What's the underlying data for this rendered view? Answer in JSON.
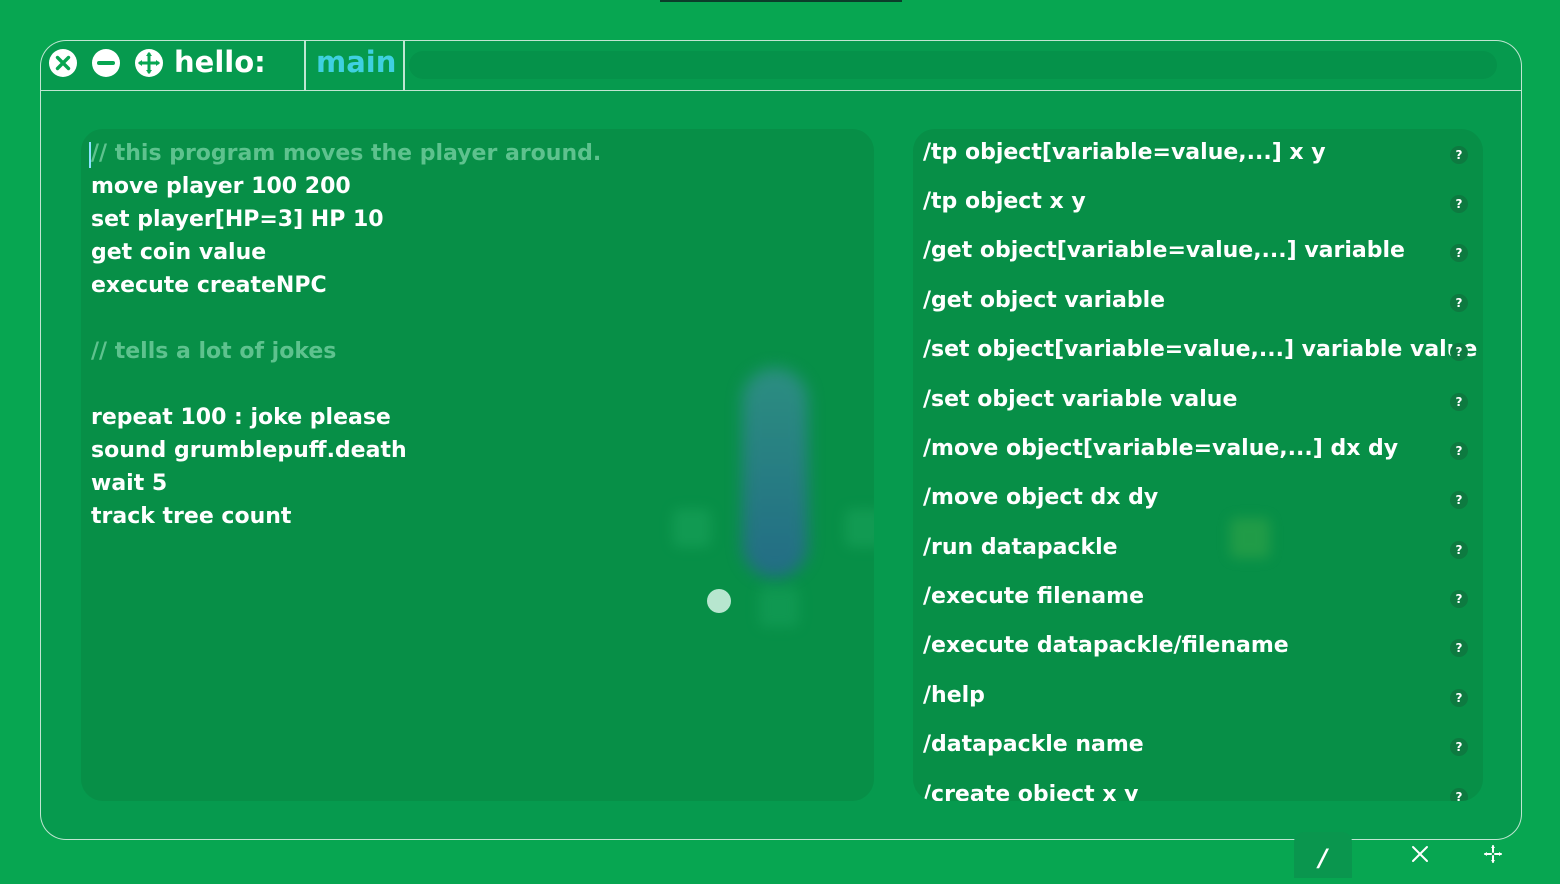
{
  "window": {
    "title": "hello:",
    "active_tab": "main"
  },
  "editor": {
    "lines": [
      {
        "text": "// this program moves the player around.",
        "comment": true
      },
      {
        "text": "move player 100 200",
        "comment": false
      },
      {
        "text": "set player[HP=3] HP 10",
        "comment": false
      },
      {
        "text": "get coin value",
        "comment": false
      },
      {
        "text": "execute createNPC",
        "comment": false
      },
      {
        "text": "// tells a lot of jokes",
        "comment": true
      },
      {
        "text": "repeat 100 : joke please",
        "comment": false
      },
      {
        "text": "sound grumblepuff.death",
        "comment": false
      },
      {
        "text": "wait 5",
        "comment": false
      },
      {
        "text": "track tree count",
        "comment": false
      }
    ]
  },
  "commands": [
    {
      "label": "/tp object[variable=value,...] x y",
      "help": "?"
    },
    {
      "label": "/tp object x y",
      "help": "?"
    },
    {
      "label": "/get object[variable=value,...] variable",
      "help": "?"
    },
    {
      "label": "/get object variable",
      "help": "?"
    },
    {
      "label": "/set object[variable=value,...] variable value",
      "help": "?"
    },
    {
      "label": "/set object variable value",
      "help": "?"
    },
    {
      "label": "/move object[variable=value,...] dx dy",
      "help": "?"
    },
    {
      "label": "/move object dx dy",
      "help": "?"
    },
    {
      "label": "/run datapackle",
      "help": "?"
    },
    {
      "label": "/execute filename",
      "help": "?"
    },
    {
      "label": "/execute datapackle/filename",
      "help": "?"
    },
    {
      "label": "/help",
      "help": "?"
    },
    {
      "label": "/datapackle name",
      "help": "?"
    },
    {
      "label": "/create object x y",
      "help": "?"
    }
  ],
  "bottom_toolbar": {
    "slash_label": "/"
  },
  "icons": {
    "close": "close-icon",
    "minimize": "minimize-icon",
    "move": "move-icon",
    "help": "help-icon",
    "x": "x-icon",
    "crosshair": "crosshair-icon"
  },
  "colors": {
    "background": "#07a651",
    "panel": "#078f47",
    "tab_active": "#3fd0e0",
    "comment": "#5ec28e"
  }
}
